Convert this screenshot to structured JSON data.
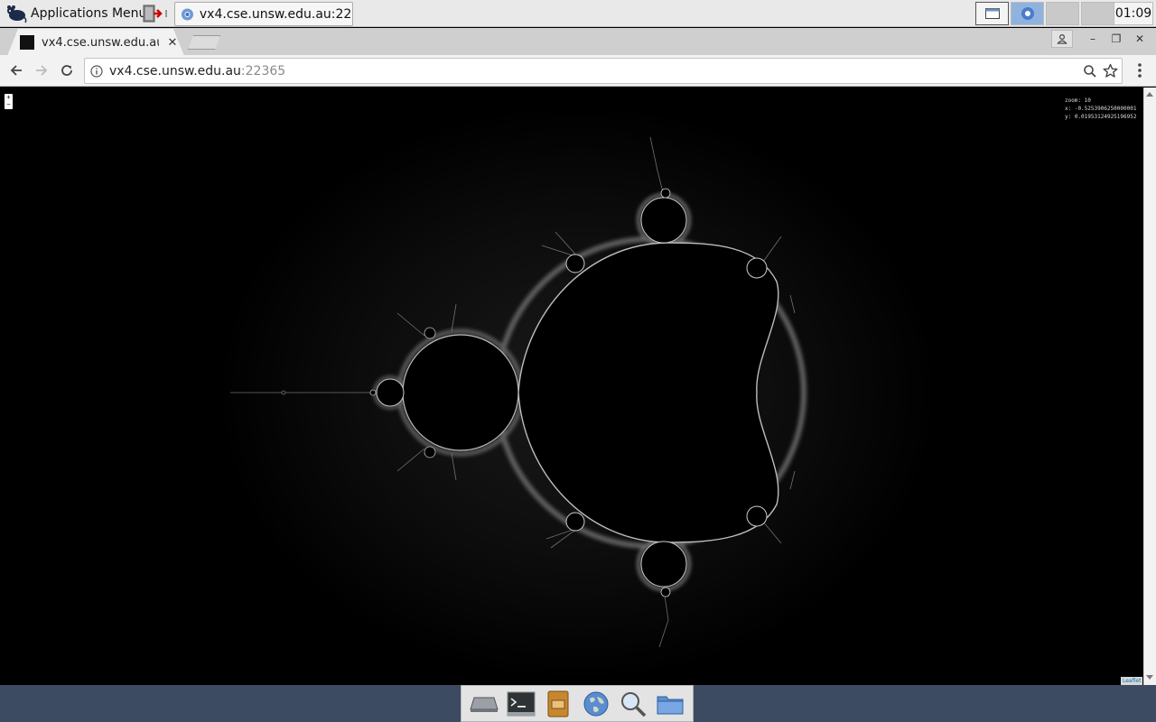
{
  "panel": {
    "apps_menu_label": "Applications Menu",
    "task_label": "vx4.cse.unsw.edu.au:22...",
    "clock": "01:09"
  },
  "tab": {
    "title": "vx4.cse.unsw.edu.au",
    "close_glyph": "✕"
  },
  "window_controls": {
    "minimize": "–",
    "restore": "❐",
    "close": "✕"
  },
  "omnibox": {
    "host": "vx4.cse.unsw.edu.au",
    "port": ":22365"
  },
  "map": {
    "zoom_in": "+",
    "zoom_out": "−",
    "info_zoom": "zoom: 10",
    "info_x": "x: -0.5253906250000001",
    "info_y": "y: 0.01953124925196952",
    "attribution": "Leaflet"
  },
  "icons": {
    "apps_menu": "xfce-mouse-icon",
    "task_favicon": "chrome-icon",
    "dock": [
      "home-drive-icon",
      "terminal-icon",
      "file-manager-icon",
      "web-browser-icon",
      "search-icon",
      "folder-icon"
    ]
  },
  "colors": {
    "fractal_background": "#000000",
    "fractal_glow": "#ffffff",
    "dock_bar": "#3c4b62"
  }
}
